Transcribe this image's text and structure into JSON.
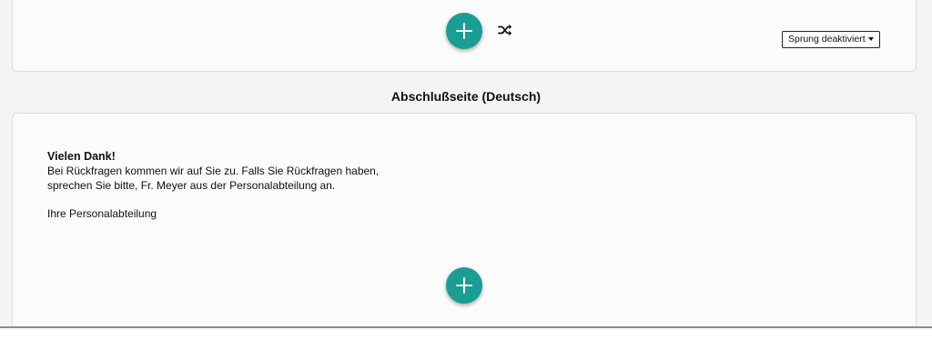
{
  "top_section": {
    "add_icon": "plus-icon",
    "shuffle_icon": "shuffle-icon",
    "jump_dropdown": {
      "selected": "Sprung deaktiviert"
    }
  },
  "closing_page": {
    "title": "Abschlußseite (Deutsch)",
    "message": {
      "heading": "Vielen Dank!",
      "line1": "Bei Rückfragen kommen wir auf Sie zu. Falls Sie Rückfragen haben,",
      "line2": "sprechen Sie bitte, Fr. Meyer aus der Personalabteilung an.",
      "signature": "Ihre Personalabteilung"
    },
    "add_icon": "plus-icon"
  },
  "colors": {
    "accent": "#1a9e94",
    "background": "#f4f4f4",
    "card": "#fbfbfb",
    "border": "#dedede"
  }
}
